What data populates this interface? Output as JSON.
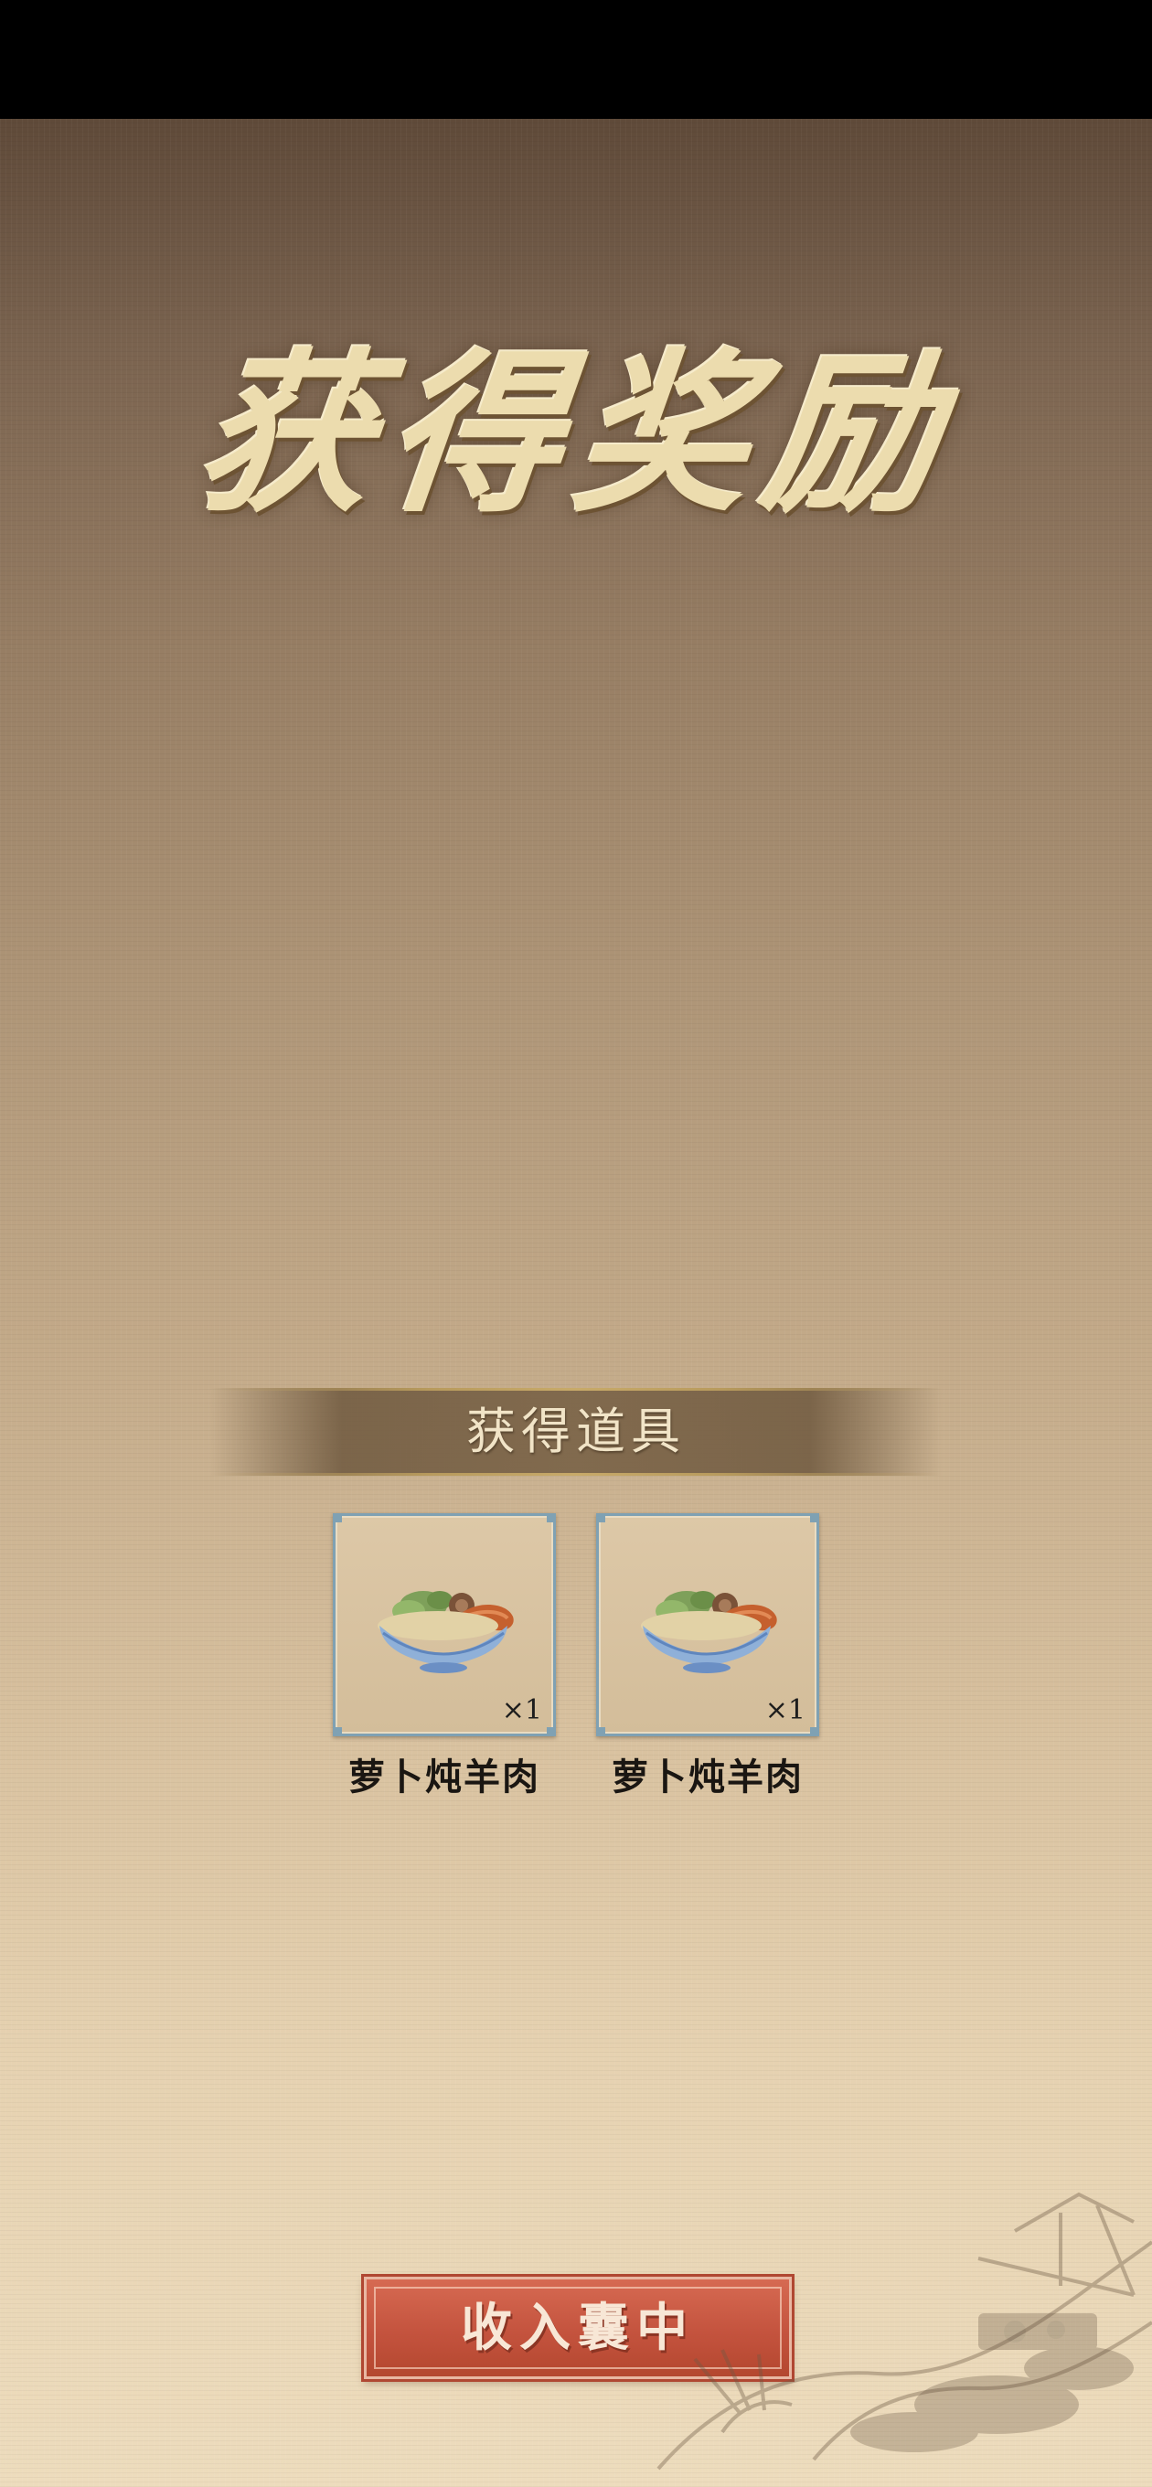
{
  "title": "获得奖励",
  "items_section": {
    "label": "获得道具",
    "items": [
      {
        "name": "萝卜炖羊肉",
        "quantity": "×1",
        "icon": "stew-bowl-icon"
      },
      {
        "name": "萝卜炖羊肉",
        "quantity": "×1",
        "icon": "stew-bowl-icon"
      }
    ]
  },
  "collect_button": {
    "label": "收入囊中"
  },
  "colors": {
    "button": "#c4533e",
    "title": "#ecdcae",
    "frame_border": "#7fa1b3"
  }
}
